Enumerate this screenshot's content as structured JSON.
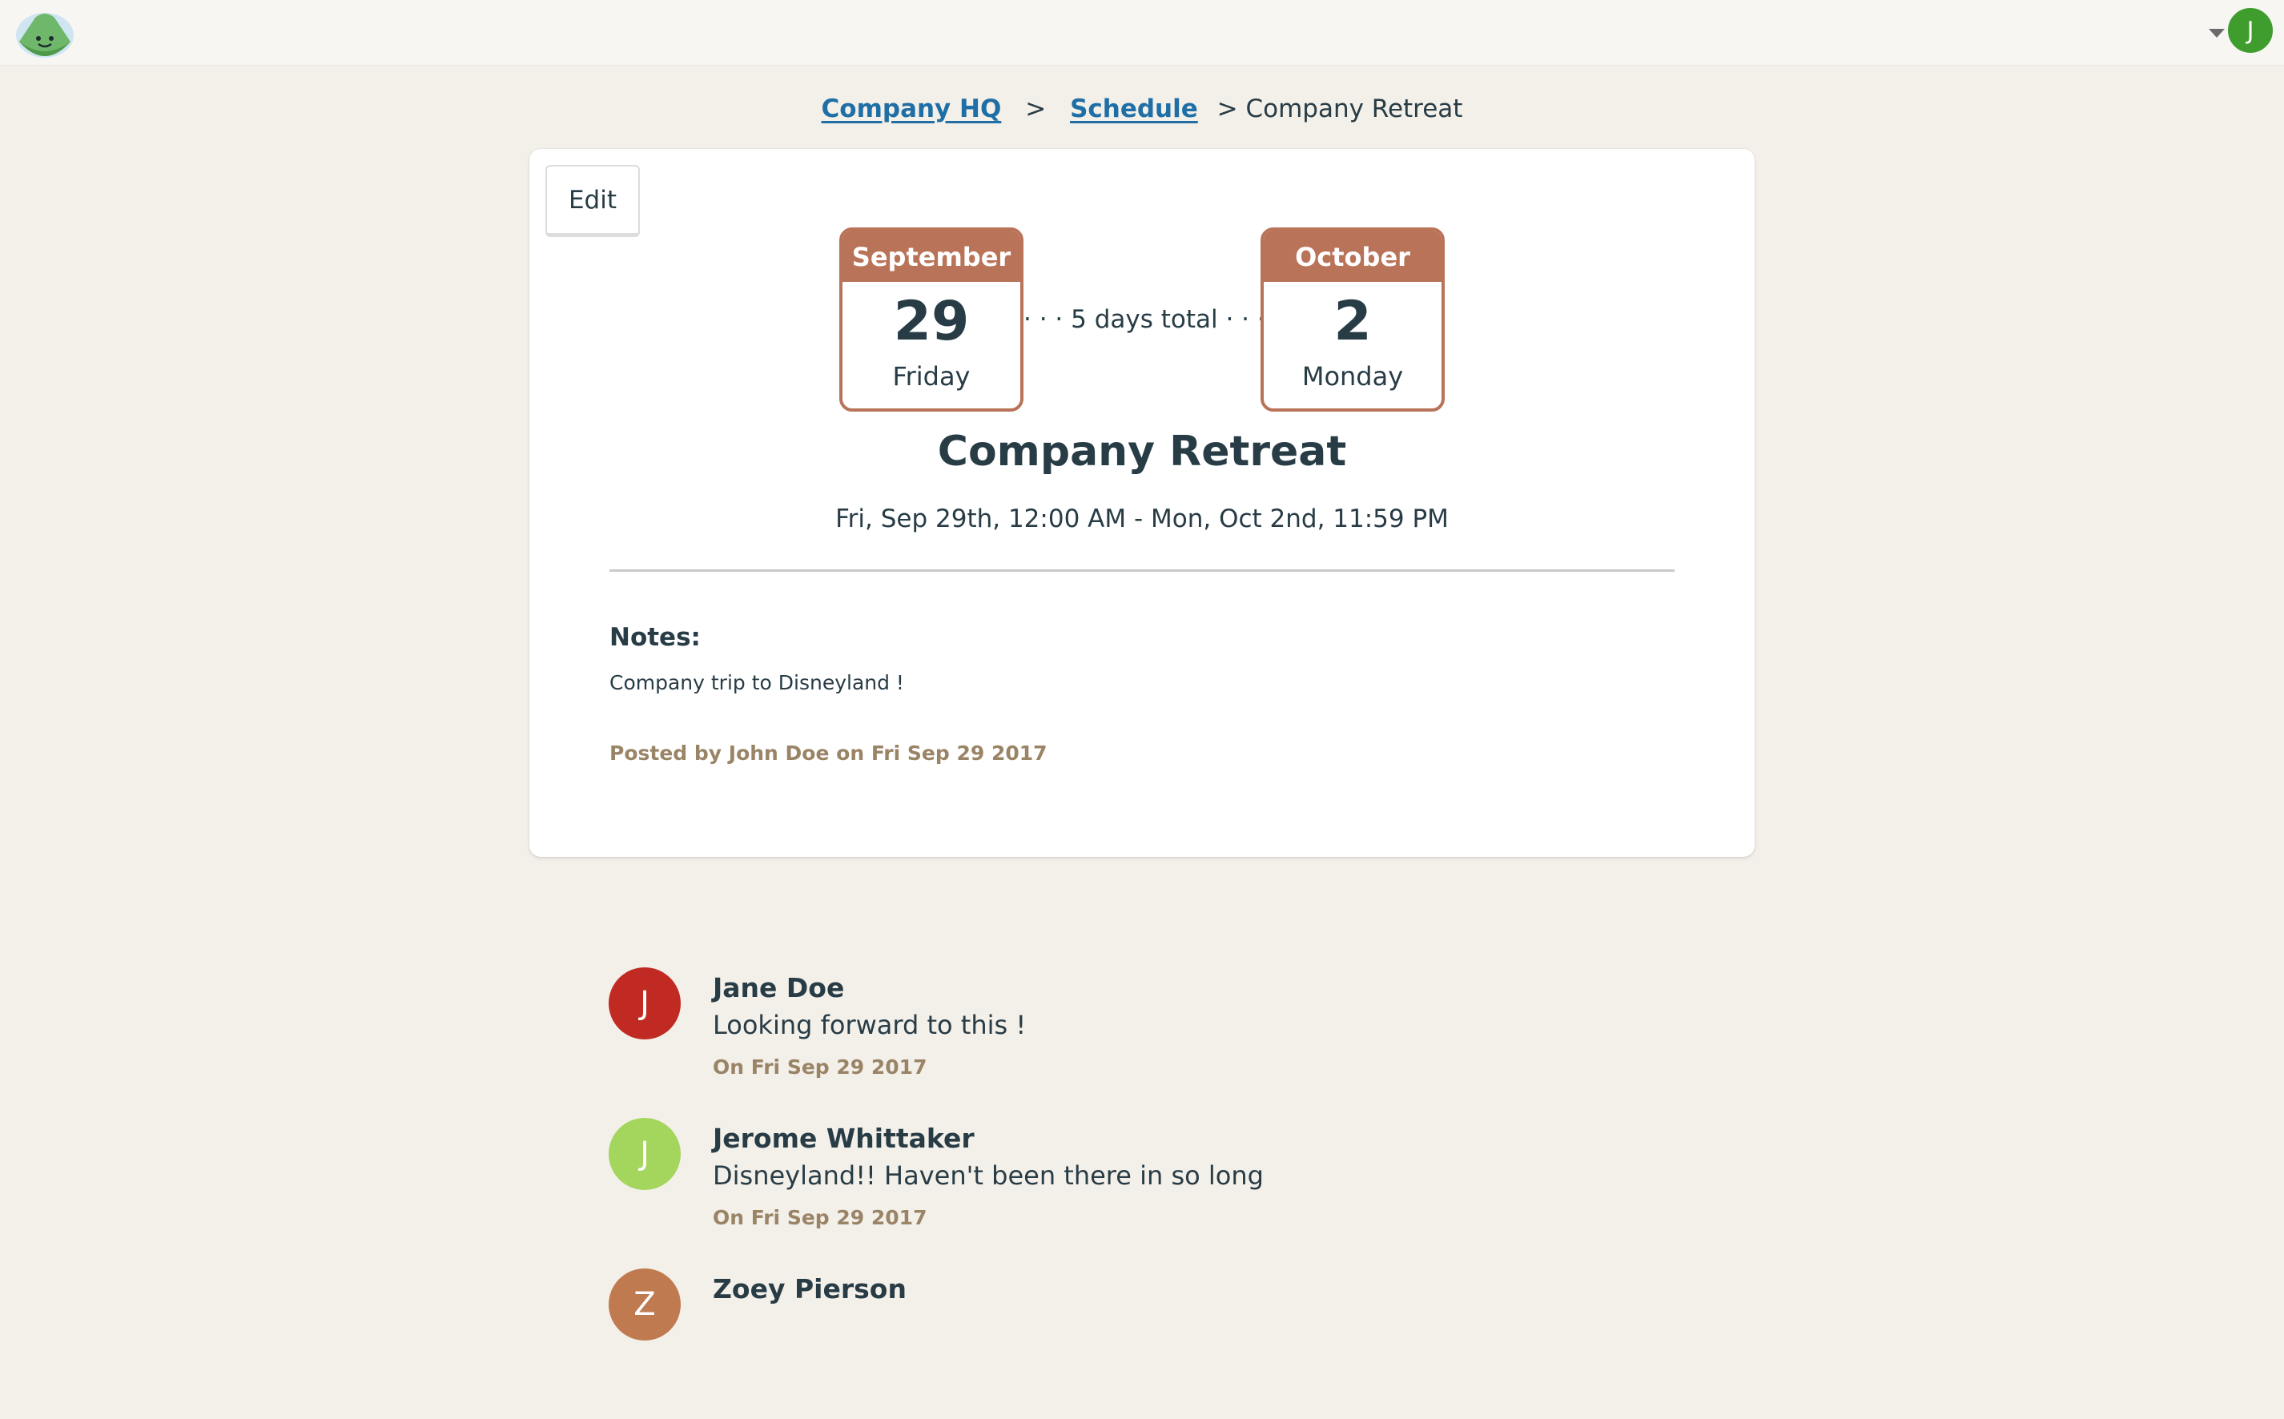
{
  "header": {
    "logo": "mountain-face-icon",
    "user_initial": "J",
    "user_color": "#3f9d2e"
  },
  "breadcrumb": {
    "items": [
      "Company HQ",
      "Schedule"
    ],
    "separator": ">",
    "current": "> Company Retreat"
  },
  "card": {
    "edit_label": "Edit",
    "start": {
      "month": "September",
      "day": "29",
      "weekday": "Friday"
    },
    "span": "· · · 5 days total · · ·",
    "end": {
      "month": "October",
      "day": "2",
      "weekday": "Monday"
    },
    "title": "Company Retreat",
    "range": "Fri, Sep 29th, 12:00 AM - Mon, Oct 2nd, 11:59 PM",
    "notes_label": "Notes:",
    "notes_text": "Company trip to Disneyland !",
    "posted": "Posted by John Doe on Fri Sep 29 2017",
    "accent_color": "#b97358"
  },
  "comments": [
    {
      "initial": "J",
      "color": "#c12a22",
      "name": "Jane Doe",
      "text": "Looking forward to this !",
      "date": "On Fri Sep 29 2017"
    },
    {
      "initial": "J",
      "color": "#a4d65e",
      "name": "Jerome Whittaker",
      "text": "Disneyland!! Haven't been there in so long",
      "date": "On Fri Sep 29 2017"
    },
    {
      "initial": "Z",
      "color": "#c07a4f",
      "name": "Zoey Pierson",
      "text": "",
      "date": ""
    }
  ]
}
